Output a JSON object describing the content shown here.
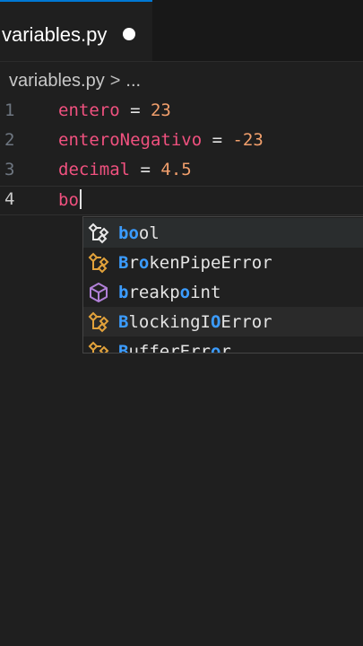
{
  "tab": {
    "filename": "variables.py",
    "dirty": true
  },
  "breadcrumb": {
    "file": "variables.py",
    "separator": ">",
    "more": "..."
  },
  "colors": {
    "accent": "#0078d4",
    "variable": "#f0517f",
    "number": "#f19f6c",
    "match_highlight": "#3b9cff",
    "class_icon": "#e2a23b",
    "function_icon": "#b180d7"
  },
  "editor": {
    "lines": [
      {
        "number": "1",
        "name": "entero",
        "op": " = ",
        "value": "23"
      },
      {
        "number": "2",
        "name": "enteroNegativo",
        "op": " = ",
        "value": "-23"
      },
      {
        "number": "3",
        "name": "decimal",
        "op": " = ",
        "value": "4.5"
      },
      {
        "number": "4",
        "typed": "bo"
      }
    ]
  },
  "suggestions": [
    {
      "match": "bo",
      "rest": "ol",
      "icon": "class-icon"
    },
    {
      "match_parts": [
        "B",
        "r",
        "o"
      ],
      "label": "BrokenPipeError",
      "icon": "class-icon"
    },
    {
      "label": "breakpoint",
      "icon": "function-cube-icon"
    },
    {
      "label": "BlockingIOError",
      "icon": "class-icon"
    },
    {
      "label": "BufferError",
      "icon": "class-icon"
    }
  ]
}
